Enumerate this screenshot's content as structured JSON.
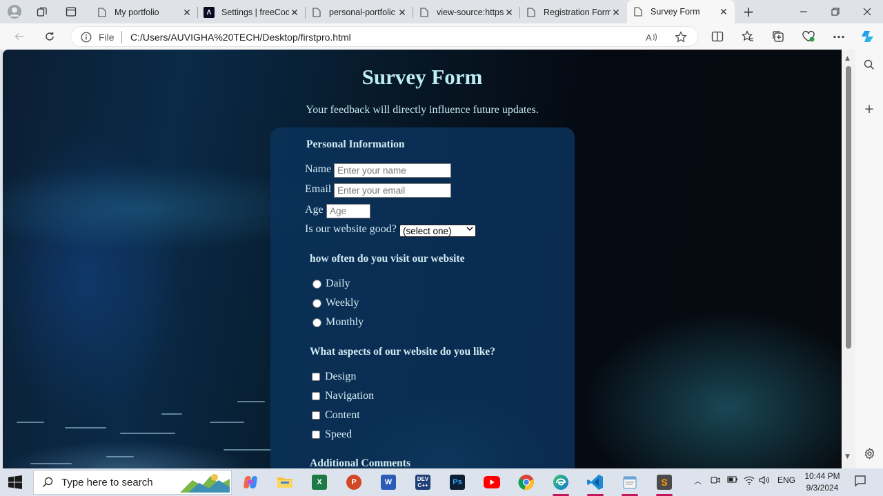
{
  "tabs": [
    {
      "title": "My portfolio",
      "favicon": "document-icon"
    },
    {
      "title": "Settings | freeCod",
      "favicon": "freecodecamp-icon"
    },
    {
      "title": "personal-portfolic",
      "favicon": "document-icon"
    },
    {
      "title": "view-source:https:",
      "favicon": "document-icon"
    },
    {
      "title": "Registration Form",
      "favicon": "document-icon"
    },
    {
      "title": "Survey Form",
      "favicon": "document-icon",
      "active": true
    }
  ],
  "address": {
    "scheme_label": "File",
    "url": "C:/Users/AUVIGHA%20TECH/Desktop/firstpro.html"
  },
  "page": {
    "title": "Survey Form",
    "description": "Your feedback will directly influence future updates.",
    "personal_info_header": "Personal Information",
    "name_label": "Name",
    "name_placeholder": "Enter your name",
    "email_label": "Email",
    "email_placeholder": "Enter your email",
    "age_label": "Age",
    "age_placeholder": "Age",
    "website_good_label": "Is our website good?",
    "website_good_selected": "(select one)",
    "visit_header": "how often do you visit our website",
    "visit_options": [
      "Daily",
      "Weekly",
      "Monthly"
    ],
    "aspects_header": "What aspects of our website do you like?",
    "aspect_options": [
      "Design",
      "Navigation",
      "Content",
      "Speed"
    ],
    "comments_header": "Additional Comments"
  },
  "taskbar": {
    "search_placeholder": "Type here to search",
    "language": "ENG",
    "time": "10:44 PM",
    "date": "9/3/2024"
  },
  "colors": {
    "form_panel": "#0a325c",
    "heading_text": "#bdeef2",
    "active_indicator": "#c2185b"
  }
}
